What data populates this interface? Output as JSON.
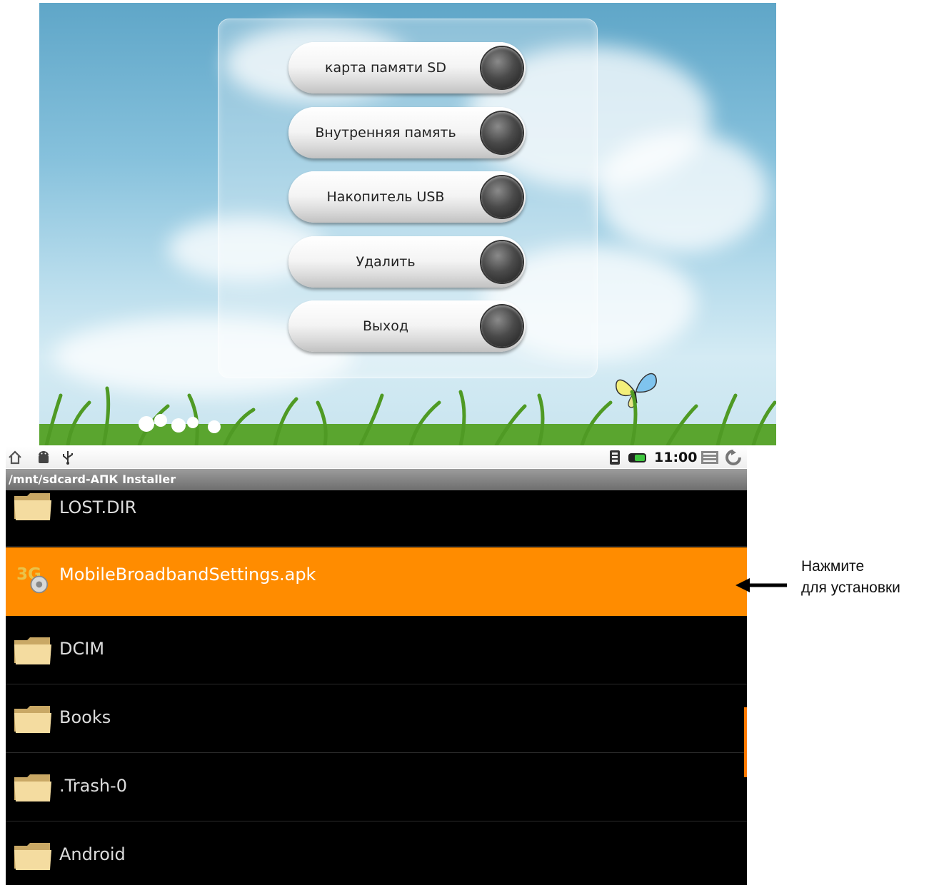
{
  "menu": {
    "buttons": [
      {
        "label": "карта памяти SD"
      },
      {
        "label": "Внутренняя память"
      },
      {
        "label": "Накопитель USB"
      },
      {
        "label": "Удалить"
      },
      {
        "label": "Выход"
      }
    ]
  },
  "status_bar": {
    "left_icons": [
      "home-icon",
      "android-icon",
      "usb-icon"
    ],
    "right_icons": [
      "signal-icon",
      "battery-icon",
      "menu-icon",
      "back-icon"
    ],
    "time": "11:00"
  },
  "file_browser": {
    "path_title": "/mnt/sdcard-АПК Installer",
    "files": [
      {
        "name": "LOST.DIR",
        "icon": "folder-icon"
      },
      {
        "name": "MobileBroadbandSettings.apk",
        "icon": "apk-icon",
        "selected": true
      },
      {
        "name": "DCIM",
        "icon": "folder-icon"
      },
      {
        "name": "Books",
        "icon": "folder-icon"
      },
      {
        "name": ".Trash-0",
        "icon": "folder-icon"
      },
      {
        "name": "Android",
        "icon": "folder-icon"
      }
    ]
  },
  "annotation": {
    "line1": "Нажмите",
    "line2": "для установки"
  },
  "colors": {
    "selection": "#ff8c00",
    "list_background": "#000000",
    "sky": "#86c1dc"
  }
}
